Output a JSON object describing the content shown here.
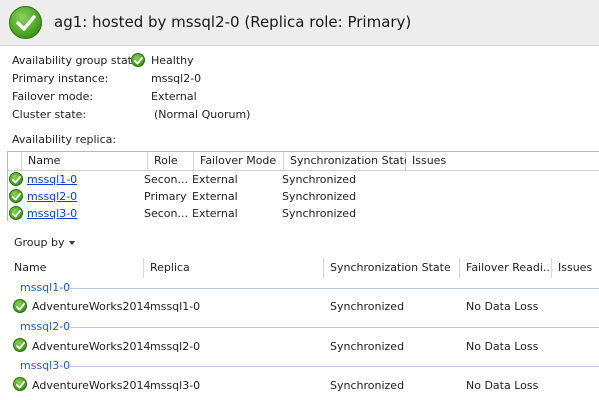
{
  "header": {
    "title": "ag1: hosted by mssql2-0 (Replica role: Primary)"
  },
  "summary": [
    {
      "label": "Availability group state:",
      "value": "Healthy",
      "has_check": true
    },
    {
      "label": "Primary instance:",
      "value": "mssql2-0",
      "has_check": false
    },
    {
      "label": "Failover mode:",
      "value": "External",
      "has_check": false
    },
    {
      "label": "Cluster state:",
      "value": "(Normal Quorum)",
      "has_check": false
    }
  ],
  "replica_section_label": "Availability replica:",
  "replica_columns": [
    "Name",
    "Role",
    "Failover Mode",
    "Synchronization State",
    "Issues"
  ],
  "replicas": [
    {
      "name": "mssql1-0",
      "role": "Secon...",
      "failover": "External",
      "sync": "Synchronized"
    },
    {
      "name": "mssql2-0",
      "role": "Primary",
      "failover": "External",
      "sync": "Synchronized"
    },
    {
      "name": "mssql3-0",
      "role": "Secon...",
      "failover": "External",
      "sync": "Synchronized"
    }
  ],
  "group_by_label": "Group by",
  "db_columns": [
    "Name",
    "Replica",
    "Synchronization State",
    "Failover Readi...",
    "Issues"
  ],
  "groups": [
    {
      "label": "mssql1-0",
      "row": {
        "name": "AdventureWorks2014",
        "replica": "mssql1-0",
        "sync": "Synchronized",
        "failover": "No Data Loss"
      }
    },
    {
      "label": "mssql2-0",
      "row": {
        "name": "AdventureWorks2014",
        "replica": "mssql2-0",
        "sync": "Synchronized",
        "failover": "No Data Loss"
      }
    },
    {
      "label": "mssql3-0",
      "row": {
        "name": "AdventureWorks2014",
        "replica": "mssql3-0",
        "sync": "Synchronized",
        "failover": "No Data Loss"
      }
    }
  ],
  "colors": {
    "accent_link": "#0b3ec9",
    "group_label": "#2a5bb0",
    "healthy_green": "#3f9b1c"
  },
  "icons": {
    "status": "green-check-icon",
    "dropdown": "caret-down-icon"
  }
}
